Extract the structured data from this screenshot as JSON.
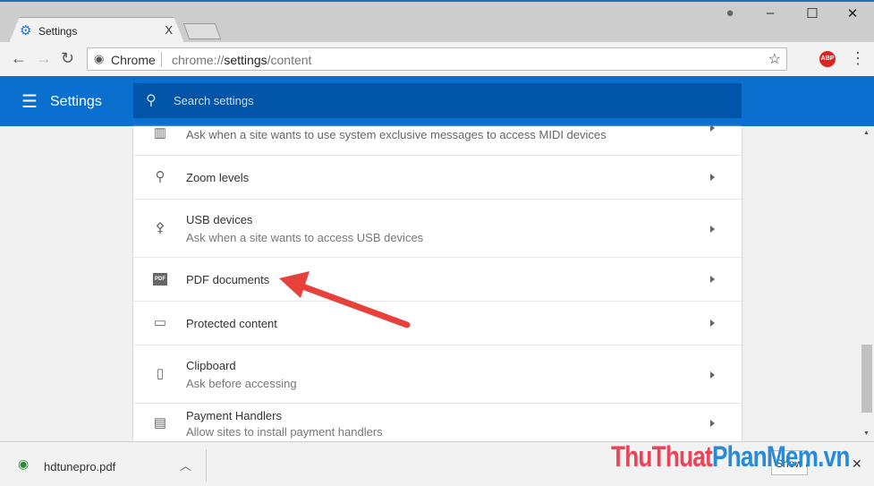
{
  "tab": {
    "title": "Settings",
    "close": "X"
  },
  "window": {
    "minimize": "–",
    "maximize": "☐",
    "close": "✕"
  },
  "omnibox": {
    "chip": "Chrome",
    "url_prefix": "chrome://",
    "url_host": "settings",
    "url_path": "/content"
  },
  "extensions": {
    "abp": "ABP"
  },
  "header": {
    "title": "Settings",
    "search_placeholder": "Search settings"
  },
  "rows": [
    {
      "title": "",
      "subtitle": "Ask when a site wants to use system exclusive messages to access MIDI devices",
      "icon": "midi-icon"
    },
    {
      "title": "Zoom levels",
      "subtitle": "",
      "icon": "search-icon"
    },
    {
      "title": "USB devices",
      "subtitle": "Ask when a site wants to access USB devices",
      "icon": "usb-icon"
    },
    {
      "title": "PDF documents",
      "subtitle": "",
      "icon": "pdf-icon"
    },
    {
      "title": "Protected content",
      "subtitle": "",
      "icon": "monitor-check-icon"
    },
    {
      "title": "Clipboard",
      "subtitle": "Ask before accessing",
      "icon": "clipboard-icon"
    },
    {
      "title": "Payment Handlers",
      "subtitle": "Allow sites to install payment handlers",
      "icon": "card-icon"
    }
  ],
  "download": {
    "file": "hdtunepro.pdf",
    "show_all": "Show all",
    "close": "✕"
  },
  "watermark": {
    "part1": "ThuThuat",
    "part2": "PhanMem.vn"
  },
  "colors": {
    "header": "#0b6fd0",
    "search": "#0055a8",
    "arrow": "#e8413c"
  }
}
